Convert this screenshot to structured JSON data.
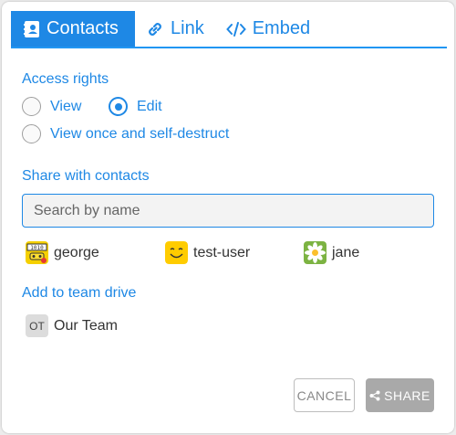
{
  "tabs": [
    {
      "label": "Contacts",
      "icon": "contact-card-icon",
      "active": true
    },
    {
      "label": "Link",
      "icon": "link-icon",
      "active": false
    },
    {
      "label": "Embed",
      "icon": "code-icon",
      "active": false
    }
  ],
  "access": {
    "title": "Access rights",
    "options": [
      {
        "label": "View",
        "checked": false
      },
      {
        "label": "Edit",
        "checked": true
      },
      {
        "label": "View once and self-destruct",
        "checked": false
      }
    ]
  },
  "share": {
    "title": "Share with contacts",
    "search_placeholder": "Search by name",
    "search_value": "",
    "contacts": [
      {
        "name": "george",
        "avatar": "binary-robot-avatar"
      },
      {
        "name": "test-user",
        "avatar": "smiley-avatar"
      },
      {
        "name": "jane",
        "avatar": "daisy-avatar"
      }
    ]
  },
  "team": {
    "title": "Add to team drive",
    "teams": [
      {
        "initials": "OT",
        "name": "Our Team"
      }
    ]
  },
  "buttons": {
    "cancel": "CANCEL",
    "share": "SHARE"
  },
  "colors": {
    "accent": "#1e88e5",
    "share_disabled": "#a9a9a9"
  }
}
